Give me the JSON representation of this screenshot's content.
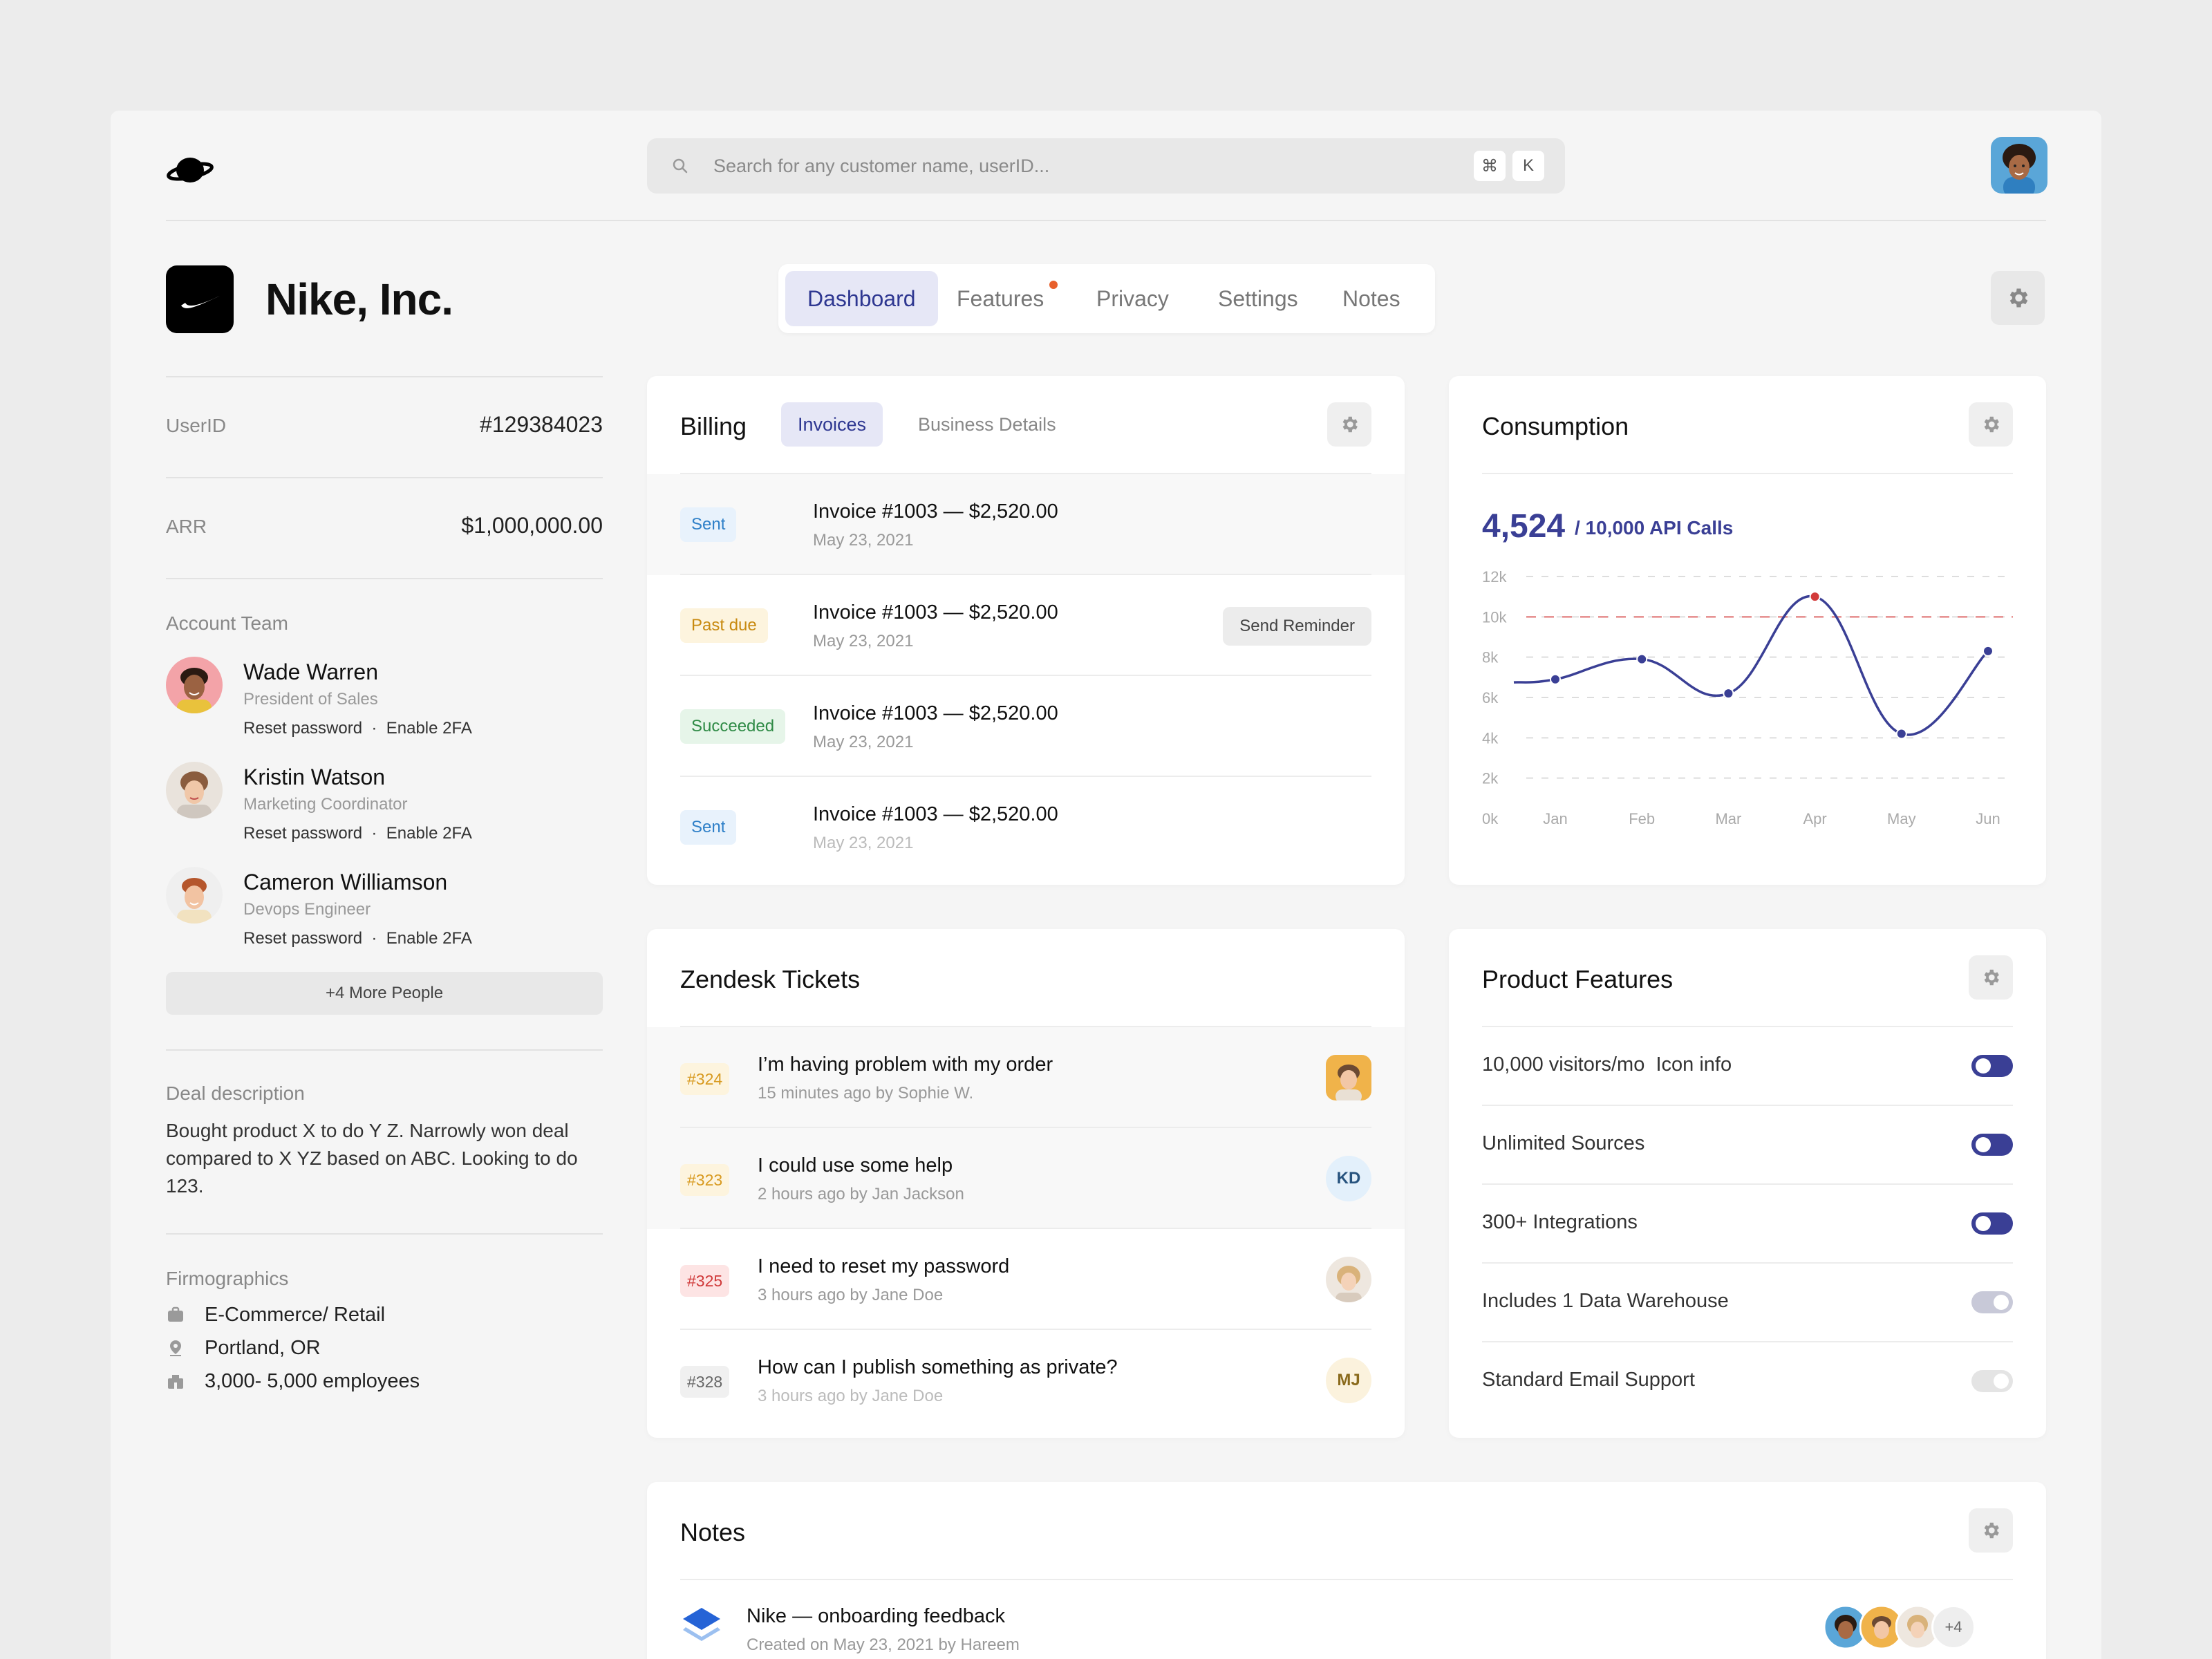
{
  "search": {
    "placeholder": "Search for any customer name, userID...",
    "kbd1": "⌘",
    "kbd2": "K"
  },
  "company": {
    "name": "Nike, Inc."
  },
  "tabs": [
    {
      "label": "Dashboard",
      "active": true
    },
    {
      "label": "Features",
      "dot": true
    },
    {
      "label": "Privacy"
    },
    {
      "label": "Settings"
    },
    {
      "label": "Notes"
    }
  ],
  "sidebar": {
    "userid_label": "UserID",
    "userid_value": "#129384023",
    "arr_label": "ARR",
    "arr_value": "$1,000,000.00",
    "team_title": "Account Team",
    "team": [
      {
        "name": "Wade Warren",
        "role": "President of Sales",
        "actions": "Reset password  ·  Enable 2FA"
      },
      {
        "name": "Kristin Watson",
        "role": "Marketing Coordinator",
        "actions": "Reset password  ·  Enable 2FA"
      },
      {
        "name": "Cameron Williamson",
        "role": "Devops Engineer",
        "actions": "Reset password  ·  Enable 2FA"
      }
    ],
    "more_people": "+4 More People",
    "deal_title": "Deal description",
    "deal_text": "Bought product X to do Y Z. Narrowly won deal compared to X YZ  based on ABC. Looking to do 123.",
    "firmo_title": "Firmographics",
    "firmo": [
      {
        "icon": "briefcase-icon",
        "text": "E-Commerce/ Retail"
      },
      {
        "icon": "location-pin-icon",
        "text": "Portland, OR"
      },
      {
        "icon": "building-icon",
        "text": "3,000- 5,000 employees"
      }
    ]
  },
  "billing": {
    "title": "Billing",
    "tab_invoices": "Invoices",
    "tab_business": "Business Details",
    "send_reminder": "Send Reminder",
    "invoices": [
      {
        "status": "Sent",
        "title": "Invoice #1003 — $2,520.00",
        "date": "May 23, 2021"
      },
      {
        "status": "Past due",
        "title": "Invoice #1003 — $2,520.00",
        "date": "May 23, 2021"
      },
      {
        "status": "Succeeded",
        "title": "Invoice #1003 — $2,520.00",
        "date": "May 23, 2021"
      },
      {
        "status": "Sent",
        "title": "Invoice #1003 — $2,520.00",
        "date": "May 23, 2021"
      }
    ]
  },
  "consumption": {
    "title": "Consumption",
    "value": "4,524",
    "limit_text": "/ 10,000 API Calls"
  },
  "chart_data": {
    "type": "line",
    "categories": [
      "Jan",
      "Feb",
      "Mar",
      "Apr",
      "May",
      "Jun"
    ],
    "values": [
      6900,
      7900,
      6200,
      11000,
      4200,
      8300
    ],
    "ylim": [
      0,
      12000
    ],
    "yticks": [
      "0k",
      "2k",
      "4k",
      "6k",
      "8k",
      "10k",
      "12k"
    ],
    "threshold": 10000,
    "colors": {
      "line": "#3a3f95",
      "peak": "#d23a3a",
      "threshold": "#e58a8a",
      "grid": "#dddddd"
    }
  },
  "tickets": {
    "title": "Zendesk Tickets",
    "items": [
      {
        "num": "#324",
        "title": "I’m having problem with my order",
        "sub": "15 minutes ago by Sophie W.",
        "avatar": ""
      },
      {
        "num": "#323",
        "title": "I could use some help",
        "sub": "2 hours ago by Jan Jackson",
        "avatar": "KD"
      },
      {
        "num": "#325",
        "title": "I need to reset my password",
        "sub": "3 hours ago by Jane Doe",
        "avatar": ""
      },
      {
        "num": "#328",
        "title": "How can I publish something as private?",
        "sub": "3 hours ago by Jane Doe",
        "avatar": "MJ"
      }
    ]
  },
  "features": {
    "title": "Product Features",
    "items": [
      {
        "label": "10,000 visitors/mo  Icon info",
        "on": true
      },
      {
        "label": "Unlimited Sources",
        "on": true
      },
      {
        "label": "300+ Integrations",
        "on": true
      },
      {
        "label": "Includes 1 Data Warehouse",
        "on": false
      },
      {
        "label": "Standard Email Support",
        "on": false
      }
    ]
  },
  "notes": {
    "title": "Notes",
    "item_title": "Nike — onboarding feedback",
    "item_sub": "Created on May 23, 2021 by Hareem",
    "more": "+4"
  }
}
